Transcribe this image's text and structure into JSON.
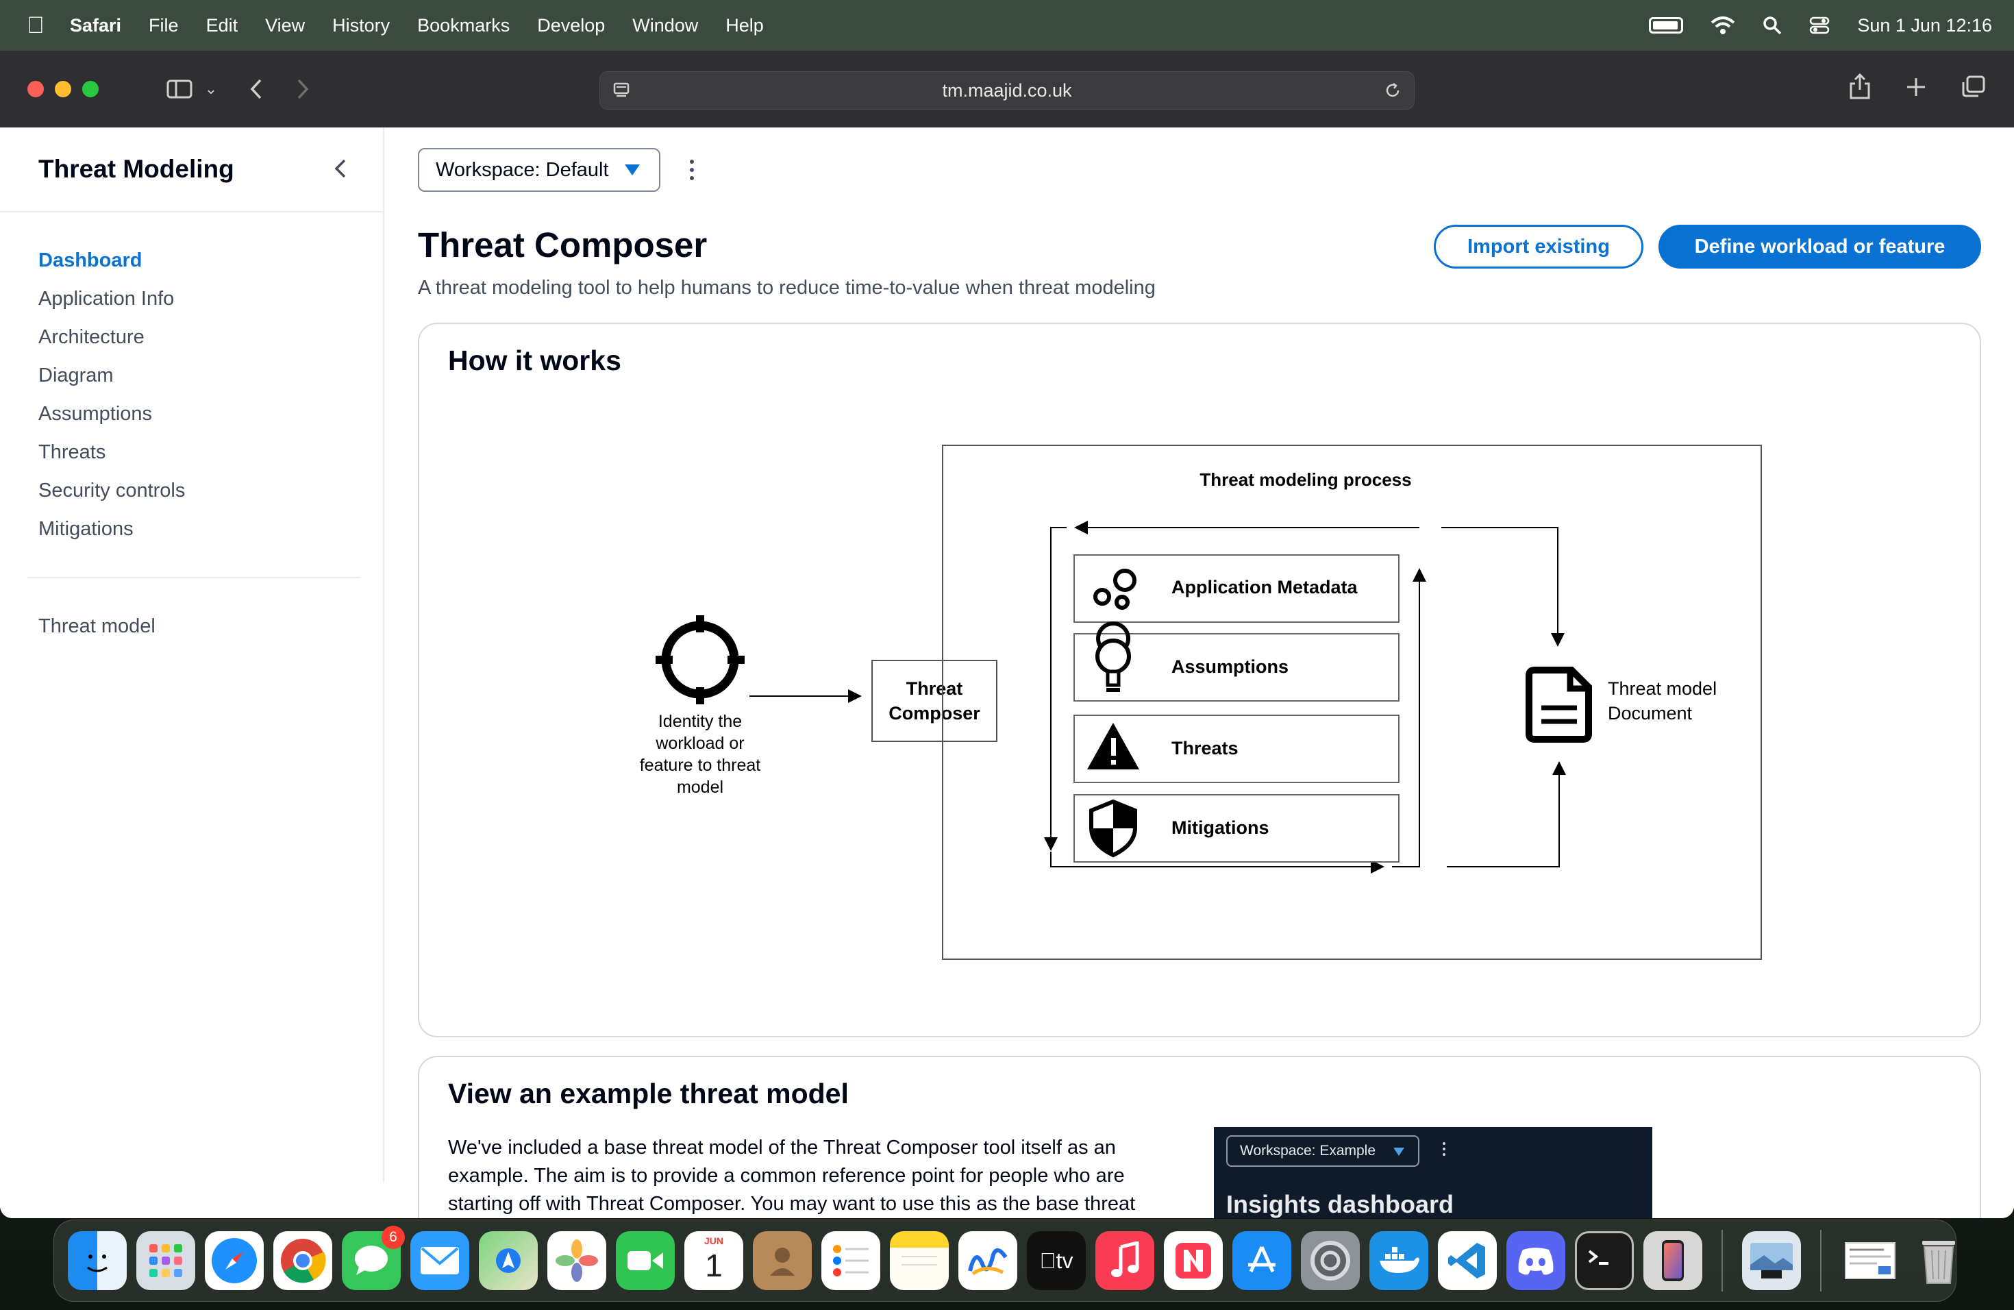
{
  "menubar": {
    "app": "Safari",
    "items": [
      "File",
      "Edit",
      "View",
      "History",
      "Bookmarks",
      "Develop",
      "Window",
      "Help"
    ],
    "datetime": "Sun 1 Jun  12:16"
  },
  "browser": {
    "url": "tm.maajid.co.uk"
  },
  "sidebar": {
    "title": "Threat Modeling",
    "items": [
      {
        "label": "Dashboard",
        "active": true
      },
      {
        "label": "Application Info"
      },
      {
        "label": "Architecture"
      },
      {
        "label": "Diagram"
      },
      {
        "label": "Assumptions"
      },
      {
        "label": "Threats"
      },
      {
        "label": "Security controls"
      },
      {
        "label": "Mitigations"
      }
    ],
    "footer_item": "Threat model"
  },
  "workspace": {
    "selected": "Workspace: Default"
  },
  "header": {
    "title": "Threat Composer",
    "subtitle": "A threat modeling tool to help humans to reduce time-to-value when threat modeling",
    "import_label": "Import existing",
    "define_label": "Define workload or feature"
  },
  "how_it_works": {
    "title": "How it works",
    "identify_lines": [
      "Identity the",
      "workload or",
      "feature to threat",
      "model"
    ],
    "composer_lines": [
      "Threat",
      "Composer"
    ],
    "process_title": "Threat modeling process",
    "process_steps": [
      "Application Metadata",
      "Assumptions",
      "Threats",
      "Mitigations"
    ],
    "output_lines": [
      "Threat model",
      "Document"
    ]
  },
  "example": {
    "title": "View an example threat model",
    "text": "We've included a base threat model of the Threat Composer tool itself as an example. The aim is to provide a common reference point for people who are starting off with Threat Composer. You may want to use this as the base threat",
    "screenshot_workspace": "Workspace: Example",
    "screenshot_title": "Insights dashboard"
  },
  "dock": {
    "messages_badge": "6",
    "calendar_month": "JUN",
    "calendar_day": "1"
  }
}
